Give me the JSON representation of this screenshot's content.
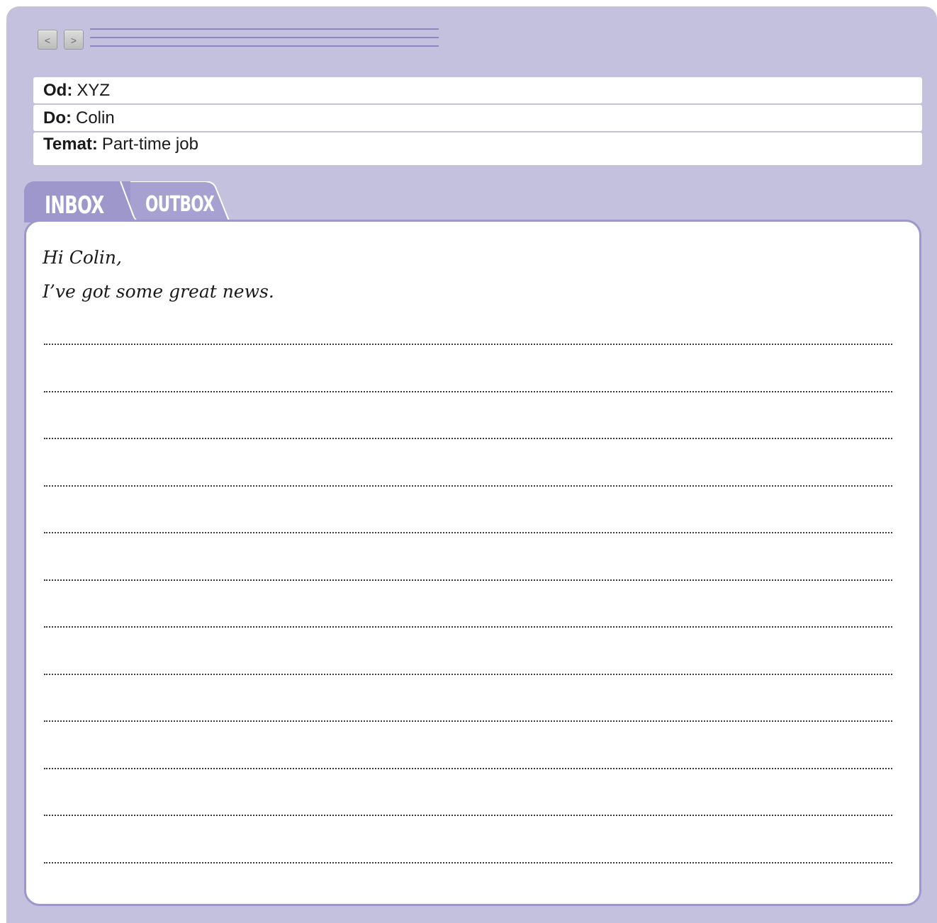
{
  "nav": {
    "back_icon": "chevron-left-icon",
    "forward_icon": "chevron-right-icon",
    "back_glyph": "<",
    "forward_glyph": ">"
  },
  "email": {
    "from": {
      "label": "Od:",
      "value": "XYZ"
    },
    "to": {
      "label": "Do:",
      "value": "Colin"
    },
    "subject": {
      "label": "Temat:",
      "value": "Part-time job"
    }
  },
  "tabs": [
    {
      "label": "INBOX",
      "active": true
    },
    {
      "label": "OUTBOX",
      "active": false
    }
  ],
  "message": {
    "greeting": "Hi Colin,",
    "opening": "I’ve got some great news."
  },
  "colors": {
    "frame": "#c4c1df",
    "accent": "#9d97cc",
    "panel": "#ffffff"
  }
}
